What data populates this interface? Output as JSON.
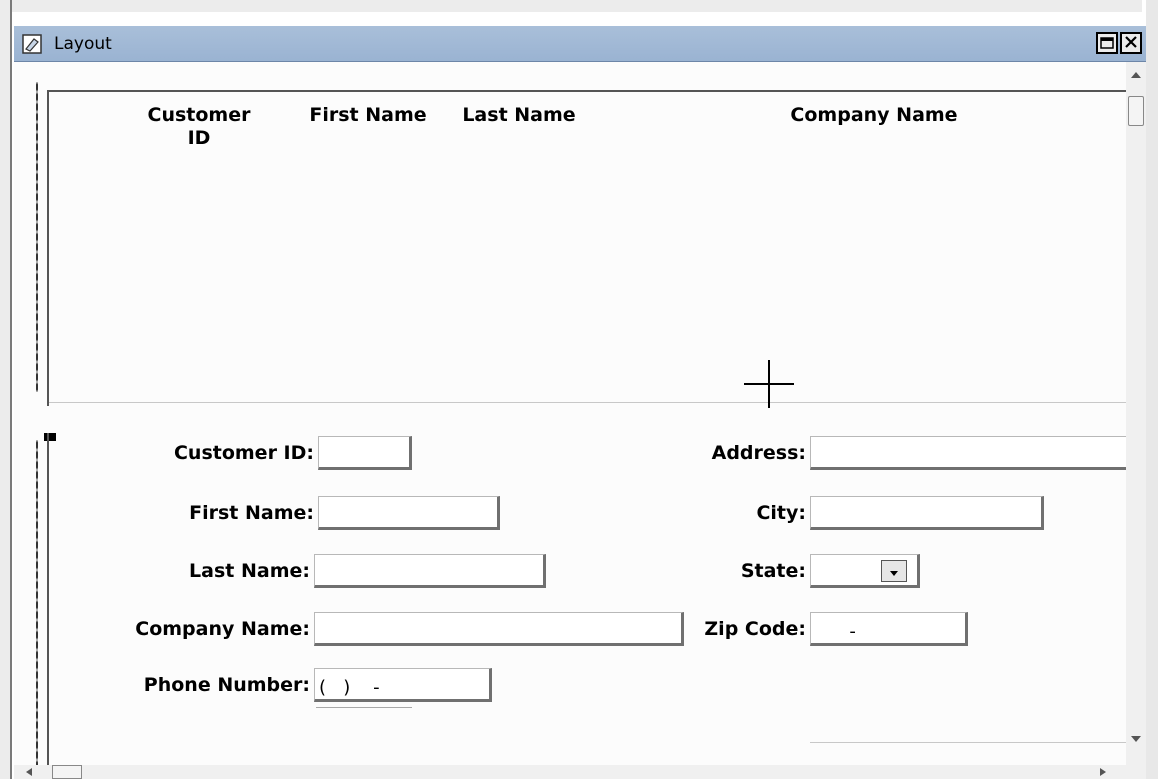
{
  "window": {
    "title": "Layout"
  },
  "title_buttons": {
    "maximize_icon": "maximize-icon",
    "close_icon": "close-icon"
  },
  "list_section": {
    "columns": [
      {
        "line1": "Customer",
        "line2": "ID"
      },
      {
        "line1": "First Name",
        "line2": ""
      },
      {
        "line1": "Last Name",
        "line2": ""
      },
      {
        "line1": "Company Name",
        "line2": ""
      }
    ]
  },
  "form": {
    "customer_id": {
      "label": "Customer ID:",
      "value": ""
    },
    "first_name": {
      "label": "First Name:",
      "value": ""
    },
    "last_name": {
      "label": "Last Name:",
      "value": ""
    },
    "company_name": {
      "label": "Company Name:",
      "value": ""
    },
    "phone_number": {
      "label": "Phone Number:",
      "value": "(   )    -"
    },
    "address": {
      "label": "Address:",
      "value": ""
    },
    "city": {
      "label": "City:",
      "value": ""
    },
    "state": {
      "label": "State:",
      "value": ""
    },
    "zip_code": {
      "label": "Zip Code:",
      "value": "      -"
    }
  }
}
